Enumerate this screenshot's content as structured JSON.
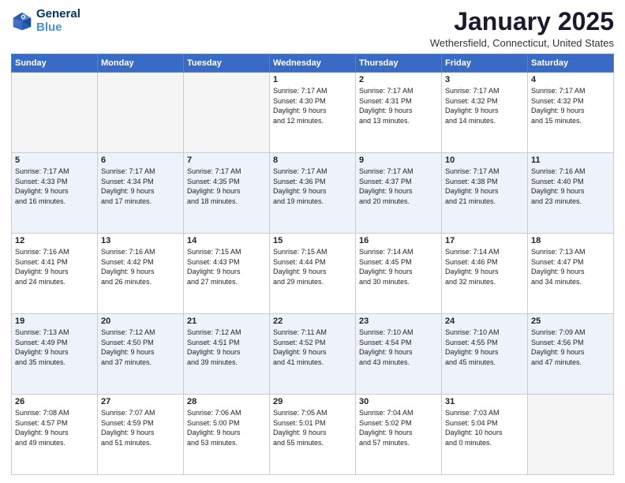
{
  "header": {
    "logo_line1": "General",
    "logo_line2": "Blue",
    "month": "January 2025",
    "location": "Wethersfield, Connecticut, United States"
  },
  "weekdays": [
    "Sunday",
    "Monday",
    "Tuesday",
    "Wednesday",
    "Thursday",
    "Friday",
    "Saturday"
  ],
  "weeks": [
    [
      {
        "day": "",
        "info": ""
      },
      {
        "day": "",
        "info": ""
      },
      {
        "day": "",
        "info": ""
      },
      {
        "day": "1",
        "info": "Sunrise: 7:17 AM\nSunset: 4:30 PM\nDaylight: 9 hours\nand 12 minutes."
      },
      {
        "day": "2",
        "info": "Sunrise: 7:17 AM\nSunset: 4:31 PM\nDaylight: 9 hours\nand 13 minutes."
      },
      {
        "day": "3",
        "info": "Sunrise: 7:17 AM\nSunset: 4:32 PM\nDaylight: 9 hours\nand 14 minutes."
      },
      {
        "day": "4",
        "info": "Sunrise: 7:17 AM\nSunset: 4:32 PM\nDaylight: 9 hours\nand 15 minutes."
      }
    ],
    [
      {
        "day": "5",
        "info": "Sunrise: 7:17 AM\nSunset: 4:33 PM\nDaylight: 9 hours\nand 16 minutes."
      },
      {
        "day": "6",
        "info": "Sunrise: 7:17 AM\nSunset: 4:34 PM\nDaylight: 9 hours\nand 17 minutes."
      },
      {
        "day": "7",
        "info": "Sunrise: 7:17 AM\nSunset: 4:35 PM\nDaylight: 9 hours\nand 18 minutes."
      },
      {
        "day": "8",
        "info": "Sunrise: 7:17 AM\nSunset: 4:36 PM\nDaylight: 9 hours\nand 19 minutes."
      },
      {
        "day": "9",
        "info": "Sunrise: 7:17 AM\nSunset: 4:37 PM\nDaylight: 9 hours\nand 20 minutes."
      },
      {
        "day": "10",
        "info": "Sunrise: 7:17 AM\nSunset: 4:38 PM\nDaylight: 9 hours\nand 21 minutes."
      },
      {
        "day": "11",
        "info": "Sunrise: 7:16 AM\nSunset: 4:40 PM\nDaylight: 9 hours\nand 23 minutes."
      }
    ],
    [
      {
        "day": "12",
        "info": "Sunrise: 7:16 AM\nSunset: 4:41 PM\nDaylight: 9 hours\nand 24 minutes."
      },
      {
        "day": "13",
        "info": "Sunrise: 7:16 AM\nSunset: 4:42 PM\nDaylight: 9 hours\nand 26 minutes."
      },
      {
        "day": "14",
        "info": "Sunrise: 7:15 AM\nSunset: 4:43 PM\nDaylight: 9 hours\nand 27 minutes."
      },
      {
        "day": "15",
        "info": "Sunrise: 7:15 AM\nSunset: 4:44 PM\nDaylight: 9 hours\nand 29 minutes."
      },
      {
        "day": "16",
        "info": "Sunrise: 7:14 AM\nSunset: 4:45 PM\nDaylight: 9 hours\nand 30 minutes."
      },
      {
        "day": "17",
        "info": "Sunrise: 7:14 AM\nSunset: 4:46 PM\nDaylight: 9 hours\nand 32 minutes."
      },
      {
        "day": "18",
        "info": "Sunrise: 7:13 AM\nSunset: 4:47 PM\nDaylight: 9 hours\nand 34 minutes."
      }
    ],
    [
      {
        "day": "19",
        "info": "Sunrise: 7:13 AM\nSunset: 4:49 PM\nDaylight: 9 hours\nand 35 minutes."
      },
      {
        "day": "20",
        "info": "Sunrise: 7:12 AM\nSunset: 4:50 PM\nDaylight: 9 hours\nand 37 minutes."
      },
      {
        "day": "21",
        "info": "Sunrise: 7:12 AM\nSunset: 4:51 PM\nDaylight: 9 hours\nand 39 minutes."
      },
      {
        "day": "22",
        "info": "Sunrise: 7:11 AM\nSunset: 4:52 PM\nDaylight: 9 hours\nand 41 minutes."
      },
      {
        "day": "23",
        "info": "Sunrise: 7:10 AM\nSunset: 4:54 PM\nDaylight: 9 hours\nand 43 minutes."
      },
      {
        "day": "24",
        "info": "Sunrise: 7:10 AM\nSunset: 4:55 PM\nDaylight: 9 hours\nand 45 minutes."
      },
      {
        "day": "25",
        "info": "Sunrise: 7:09 AM\nSunset: 4:56 PM\nDaylight: 9 hours\nand 47 minutes."
      }
    ],
    [
      {
        "day": "26",
        "info": "Sunrise: 7:08 AM\nSunset: 4:57 PM\nDaylight: 9 hours\nand 49 minutes."
      },
      {
        "day": "27",
        "info": "Sunrise: 7:07 AM\nSunset: 4:59 PM\nDaylight: 9 hours\nand 51 minutes."
      },
      {
        "day": "28",
        "info": "Sunrise: 7:06 AM\nSunset: 5:00 PM\nDaylight: 9 hours\nand 53 minutes."
      },
      {
        "day": "29",
        "info": "Sunrise: 7:05 AM\nSunset: 5:01 PM\nDaylight: 9 hours\nand 55 minutes."
      },
      {
        "day": "30",
        "info": "Sunrise: 7:04 AM\nSunset: 5:02 PM\nDaylight: 9 hours\nand 57 minutes."
      },
      {
        "day": "31",
        "info": "Sunrise: 7:03 AM\nSunset: 5:04 PM\nDaylight: 10 hours\nand 0 minutes."
      },
      {
        "day": "",
        "info": ""
      }
    ]
  ]
}
